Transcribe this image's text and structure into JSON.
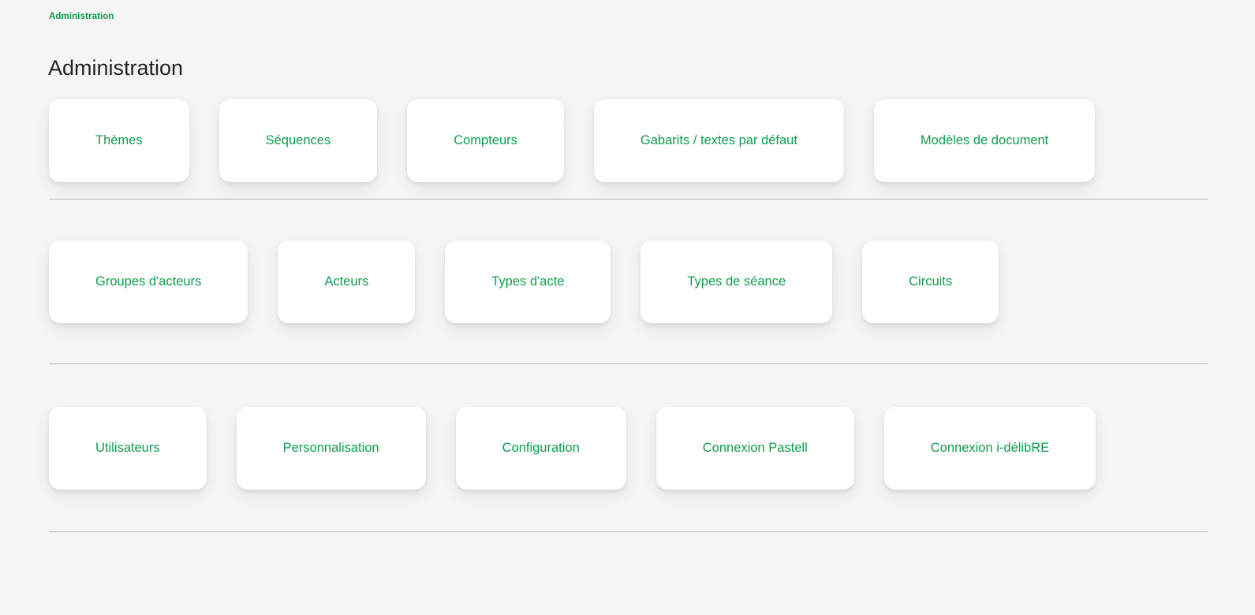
{
  "header": {
    "breadcrumb": "Administration",
    "title": "Administration"
  },
  "colors": {
    "accent_green": "#0f9d4f",
    "breadcrumb_green": "#0b9b4c",
    "page_background": "#f5f5f5",
    "card_background": "#ffffff",
    "divider": "#b6b6b6",
    "title_text": "#222222"
  },
  "sections": [
    {
      "name": "contenu",
      "cards": [
        {
          "label": "Thèmes"
        },
        {
          "label": "Séquences"
        },
        {
          "label": "Compteurs"
        },
        {
          "label": "Gabarits / textes par défaut"
        },
        {
          "label": "Modèles de document"
        }
      ]
    },
    {
      "name": "acteurs-et-circuits",
      "cards": [
        {
          "label": "Groupes d'acteurs"
        },
        {
          "label": "Acteurs"
        },
        {
          "label": "Types d'acte"
        },
        {
          "label": "Types de séance"
        },
        {
          "label": "Circuits"
        }
      ]
    },
    {
      "name": "parametrage",
      "cards": [
        {
          "label": "Utilisateurs"
        },
        {
          "label": "Personnalisation"
        },
        {
          "label": "Configuration"
        },
        {
          "label": "Connexion Pastell"
        },
        {
          "label": "Connexion i-délibRE"
        }
      ]
    }
  ]
}
